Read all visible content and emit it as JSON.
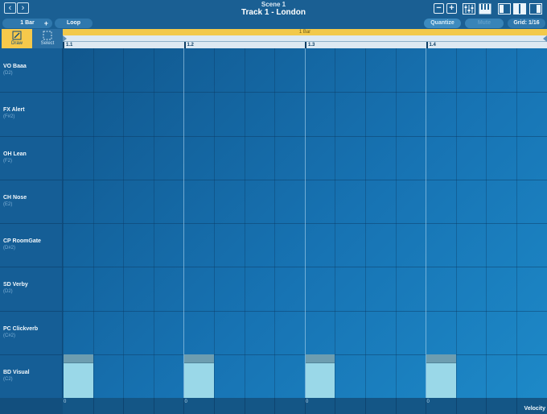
{
  "header": {
    "scene": "Scene 1",
    "track": "Track 1 - London",
    "back_icon": "chevron-left-icon",
    "forward_icon": "chevron-right-icon",
    "zoom_out_icon": "minus-icon",
    "zoom_in_icon": "plus-icon"
  },
  "toolbar": {
    "length_label": "1 Bar",
    "length_plus": "+",
    "loop_label": "Loop",
    "quantize_label": "Quantize",
    "disabled_label": "Mute",
    "grid_label": "Grid: 1/16"
  },
  "tools": {
    "draw": "Draw",
    "select": "Select"
  },
  "ruler": {
    "loop_label": "1 Bar",
    "marks": [
      "1.1",
      "1.2",
      "1.3",
      "1.4"
    ]
  },
  "lanes": [
    {
      "name": "VO Baaa",
      "note": "(D2)"
    },
    {
      "name": "FX Alert",
      "note": "(F#2)"
    },
    {
      "name": "OH Lean",
      "note": "(F2)"
    },
    {
      "name": "CH Nose",
      "note": "(E2)"
    },
    {
      "name": "CP RoomGate",
      "note": "(D#2)"
    },
    {
      "name": "SD Verby",
      "note": "(D2)"
    },
    {
      "name": "PC Clickverb",
      "note": "(C#2)"
    },
    {
      "name": "BD Visual",
      "note": "(C2)"
    }
  ],
  "notes": [
    {
      "lane": 7,
      "step": 0,
      "length_steps": 1
    },
    {
      "lane": 7,
      "step": 4,
      "length_steps": 1
    },
    {
      "lane": 7,
      "step": 8,
      "length_steps": 1
    },
    {
      "lane": 7,
      "step": 12,
      "length_steps": 1
    }
  ],
  "velocity": {
    "label": "Velocity",
    "marks": [
      "0",
      "0",
      "0",
      "0"
    ]
  },
  "colors": {
    "accent_yellow": "#f6c94b",
    "note_fill": "#9ad8e8",
    "background": "#135f98"
  }
}
